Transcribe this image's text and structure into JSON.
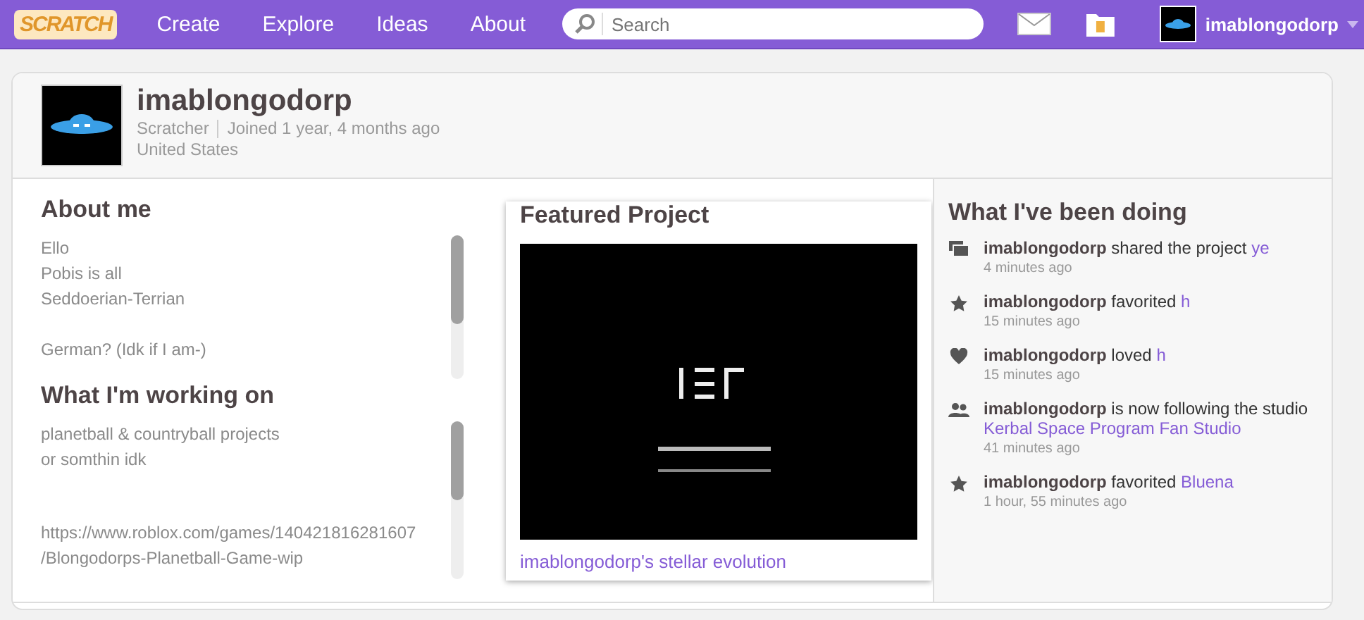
{
  "nav": {
    "logo": "SCRATCH",
    "links": [
      "Create",
      "Explore",
      "Ideas",
      "About"
    ],
    "search": {
      "placeholder": "Search"
    },
    "user": "imablongodorp"
  },
  "profile": {
    "username": "imablongodorp",
    "role": "Scratcher",
    "joined": "Joined 1 year, 4 months ago",
    "country": "United States"
  },
  "about_me": {
    "title": "About me",
    "paragraphs": [
      [
        "Ello",
        "Pobis is all",
        "Seddoerian-Terrian"
      ],
      [
        "German? (Idk if I am-)"
      ]
    ]
  },
  "working_on": {
    "title": "What I'm working on",
    "paragraphs": [
      [
        "planetball & countryball projects",
        "or somthin idk"
      ],
      [
        "https://www.roblox.com/games/140421816281607",
        "/Blongodorps-Planetball-Game-wip"
      ]
    ]
  },
  "featured": {
    "title": "Featured Project",
    "caption": "imablongodorp's stellar evolution"
  },
  "activity": {
    "title": "What I've been doing",
    "items": [
      {
        "kind": "share",
        "actor": "imablongodorp",
        "action": "shared the project",
        "target": "ye",
        "time": "4 minutes ago"
      },
      {
        "kind": "favorite",
        "actor": "imablongodorp",
        "action": "favorited",
        "target": "h",
        "time": "15 minutes ago"
      },
      {
        "kind": "love",
        "actor": "imablongodorp",
        "action": "loved",
        "target": "h",
        "time": "15 minutes ago"
      },
      {
        "kind": "follow",
        "actor": "imablongodorp",
        "action": "is now following the studio",
        "target": "Kerbal Space Program Fan Studio",
        "time": "41 minutes ago"
      },
      {
        "kind": "favorite",
        "actor": "imablongodorp",
        "action": "favorited",
        "target": "Bluena",
        "time": "1 hour, 55 minutes ago"
      }
    ]
  }
}
